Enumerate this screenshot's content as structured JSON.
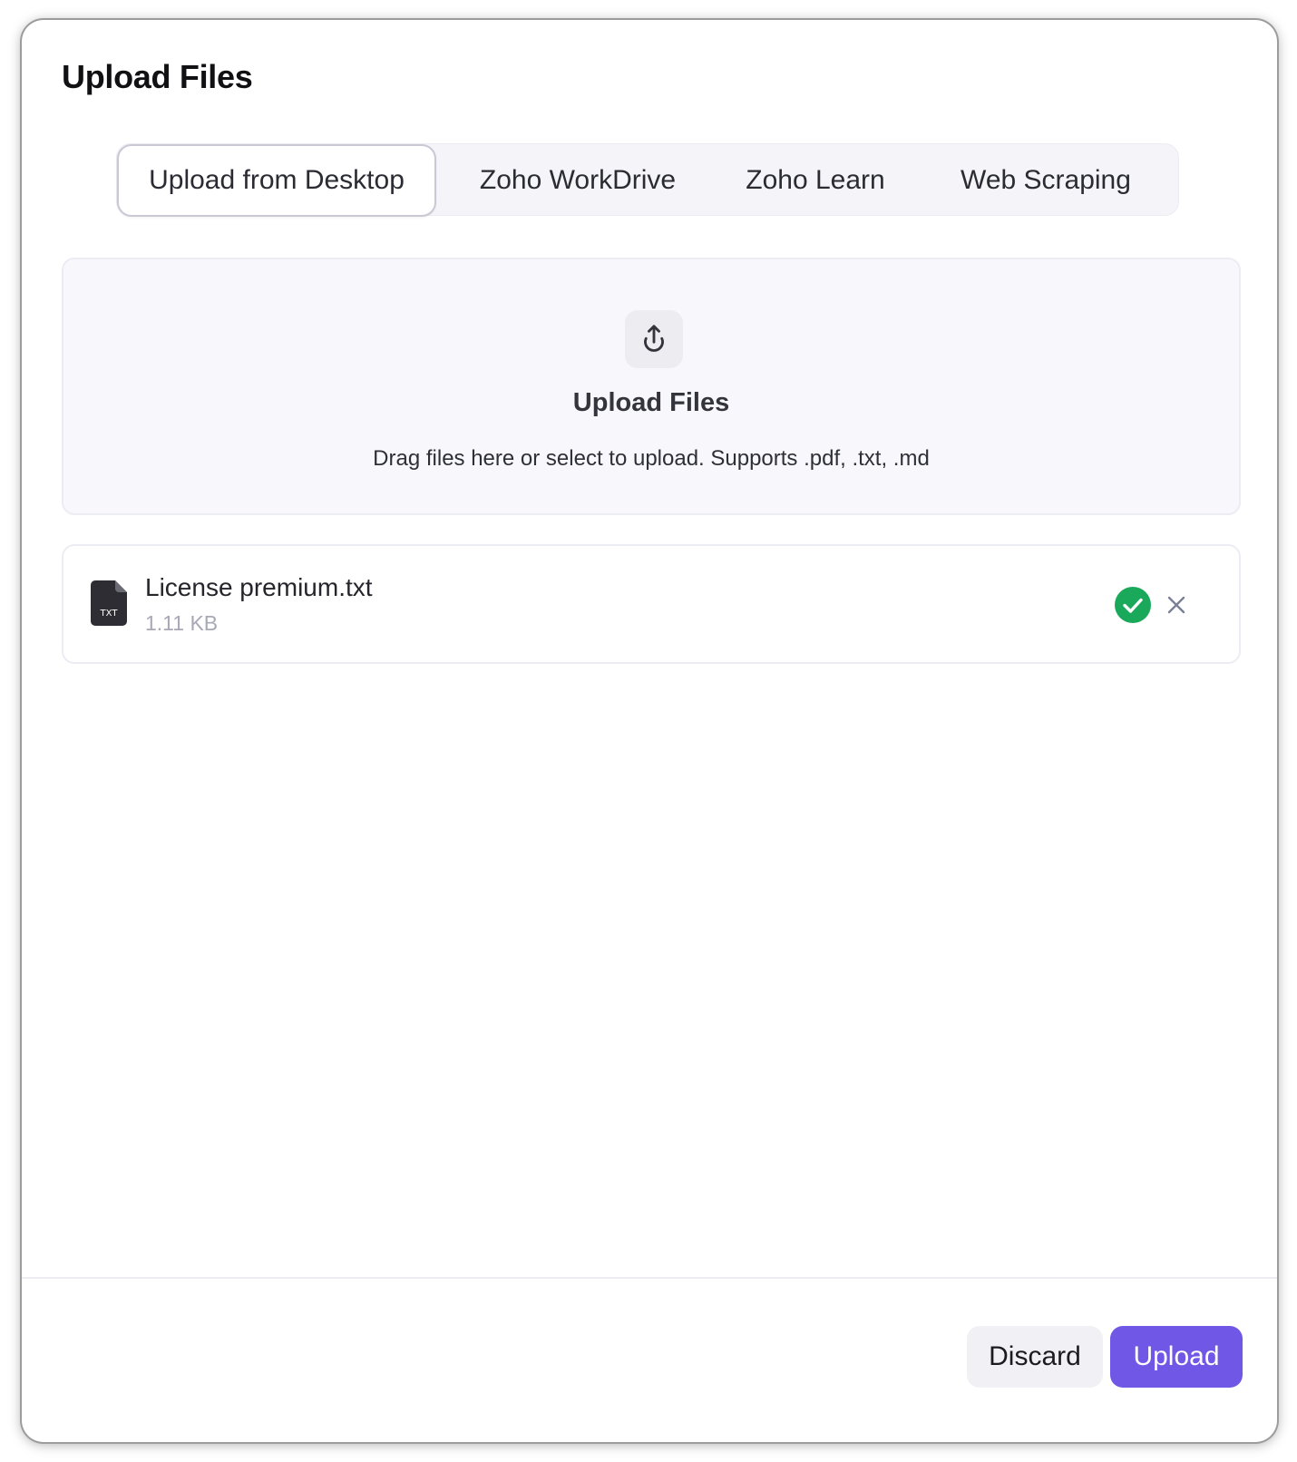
{
  "dialog": {
    "title": "Upload Files"
  },
  "tabs": [
    {
      "label": "Upload from Desktop",
      "active": true
    },
    {
      "label": "Zoho WorkDrive",
      "active": false
    },
    {
      "label": "Zoho Learn",
      "active": false
    },
    {
      "label": "Web Scraping",
      "active": false
    }
  ],
  "dropzone": {
    "icon": "upload-icon",
    "title": "Upload Files",
    "subtitle": "Drag files here or select to upload. Supports .pdf, .txt, .md"
  },
  "files": [
    {
      "name": "License premium.txt",
      "size": "1.11 KB",
      "type_badge": "TXT",
      "status": "uploaded",
      "status_icon": "check-circle-icon",
      "remove_icon": "close-icon"
    }
  ],
  "footer": {
    "discard_label": "Discard",
    "upload_label": "Upload"
  },
  "colors": {
    "accent": "#7057e6",
    "success": "#1aa85a"
  }
}
